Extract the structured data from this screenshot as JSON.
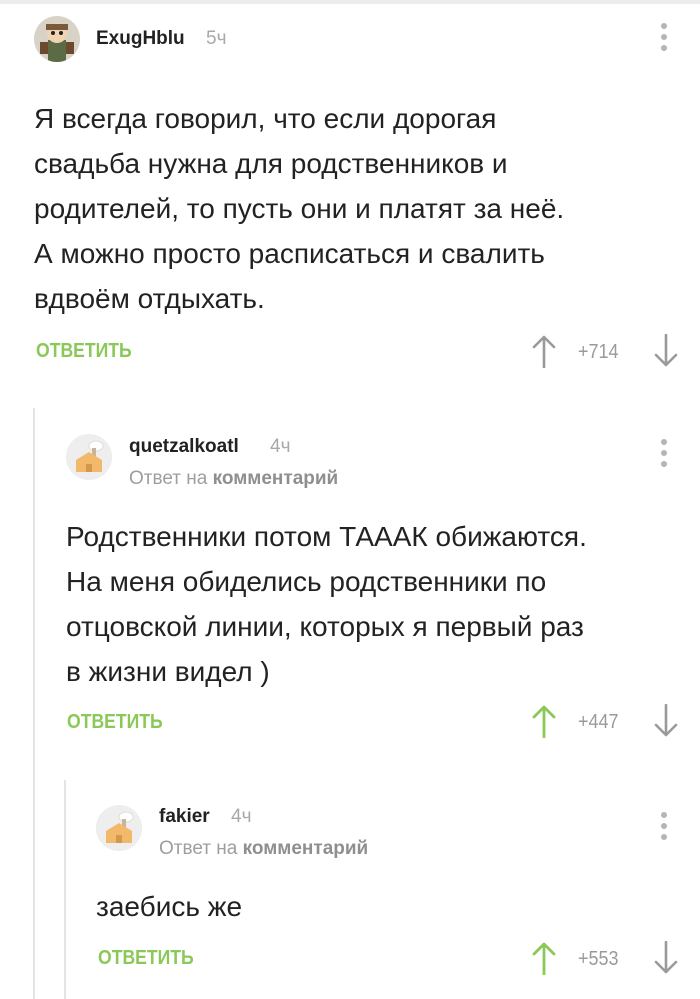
{
  "comments": [
    {
      "username": "ExugHblu",
      "time": "5ч",
      "text": "Я всегда говорил, что если дорогая\nсвадьба нужна для родственников и\nродителей, то пусть они и платят за неё.\nА можно просто расписаться и свалить\nвдвоём отдыхать.",
      "reply_label": "ОТВЕТИТЬ",
      "score": "+714",
      "upvoted": false
    },
    {
      "username": "quetzalkoatl",
      "time": "4ч",
      "reply_prefix": "Ответ на",
      "reply_target": "комментарий",
      "text": "Родственники потом ТАААК обижаются.\nНа меня обиделись родственники по\nотцовской линии, которых я первый раз\nв жизни видел )",
      "reply_label": "ОТВЕТИТЬ",
      "score": "+447",
      "upvoted": true
    },
    {
      "username": "fakier",
      "time": "4ч",
      "reply_prefix": "Ответ на",
      "reply_target": "комментарий",
      "text": "заебись же",
      "reply_label": "ОТВЕТИТЬ",
      "score": "+553",
      "upvoted": true
    }
  ],
  "colors": {
    "accent_green": "#8ac858",
    "neutral_arrow": "#9a9a9a",
    "thread_line": "#e4e4e4"
  },
  "icons": {
    "upvote": "arrow-up-icon",
    "downvote": "arrow-down-icon",
    "menu": "more-vertical-icon"
  }
}
